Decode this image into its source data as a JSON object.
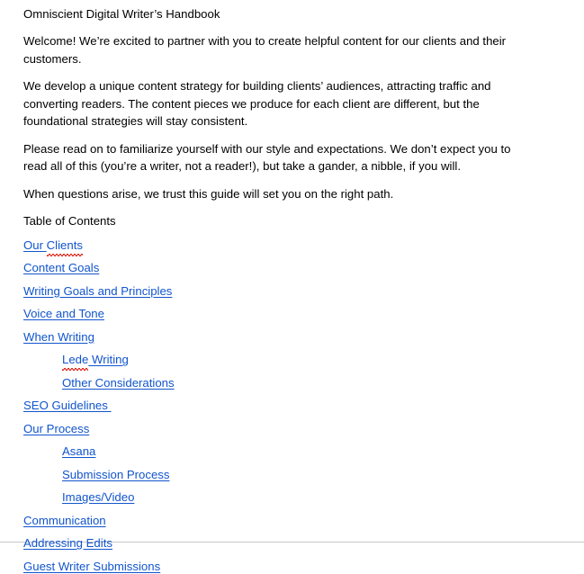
{
  "document": {
    "title": "Omniscient Digital Writer’s Handbook",
    "paragraphs": [
      "Welcome! We’re excited to partner with you to create helpful content for our clients and their customers.",
      "We develop a unique content strategy for building clients’ audiences, attracting traffic and converting readers. The content pieces we produce for each client are different, but the foundational strategies will stay consistent.",
      "Please read on to familiarize yourself with our style and expectations. We don’t expect you to read all of this (you’re a writer, not a reader!), but take a gander, a nibble, if you will.",
      "When questions arise, we trust this guide will set you on the right path."
    ],
    "toc_heading": "Table of Contents",
    "toc": [
      {
        "label": "Our Clients",
        "level": 1,
        "misspelled_part": "Clients",
        "prefix": "Our "
      },
      {
        "label": "Content Goals",
        "level": 1
      },
      {
        "label": "Writing Goals and Principles",
        "level": 1
      },
      {
        "label": "Voice and Tone",
        "level": 1
      },
      {
        "label": "When Writing",
        "level": 1
      },
      {
        "label": "Lede Writing",
        "level": 2,
        "misspelled_part": "Lede",
        "prefix": ""
      },
      {
        "label": "Other Considerations",
        "level": 2
      },
      {
        "label": "SEO Guidelines ",
        "level": 1
      },
      {
        "label": "Our Process",
        "level": 1
      },
      {
        "label": "Asana",
        "level": 2
      },
      {
        "label": "Submission Process",
        "level": 2
      },
      {
        "label": "Images/Video",
        "level": 2
      },
      {
        "label": "Communication",
        "level": 1
      },
      {
        "label": "Addressing Edits",
        "level": 1
      },
      {
        "label": "Guest Writer Submissions",
        "level": 1
      }
    ]
  },
  "colors": {
    "link": "#1155cc",
    "text": "#000000",
    "spellcheck": "#e02b20",
    "page_border": "#c8c8c8"
  }
}
